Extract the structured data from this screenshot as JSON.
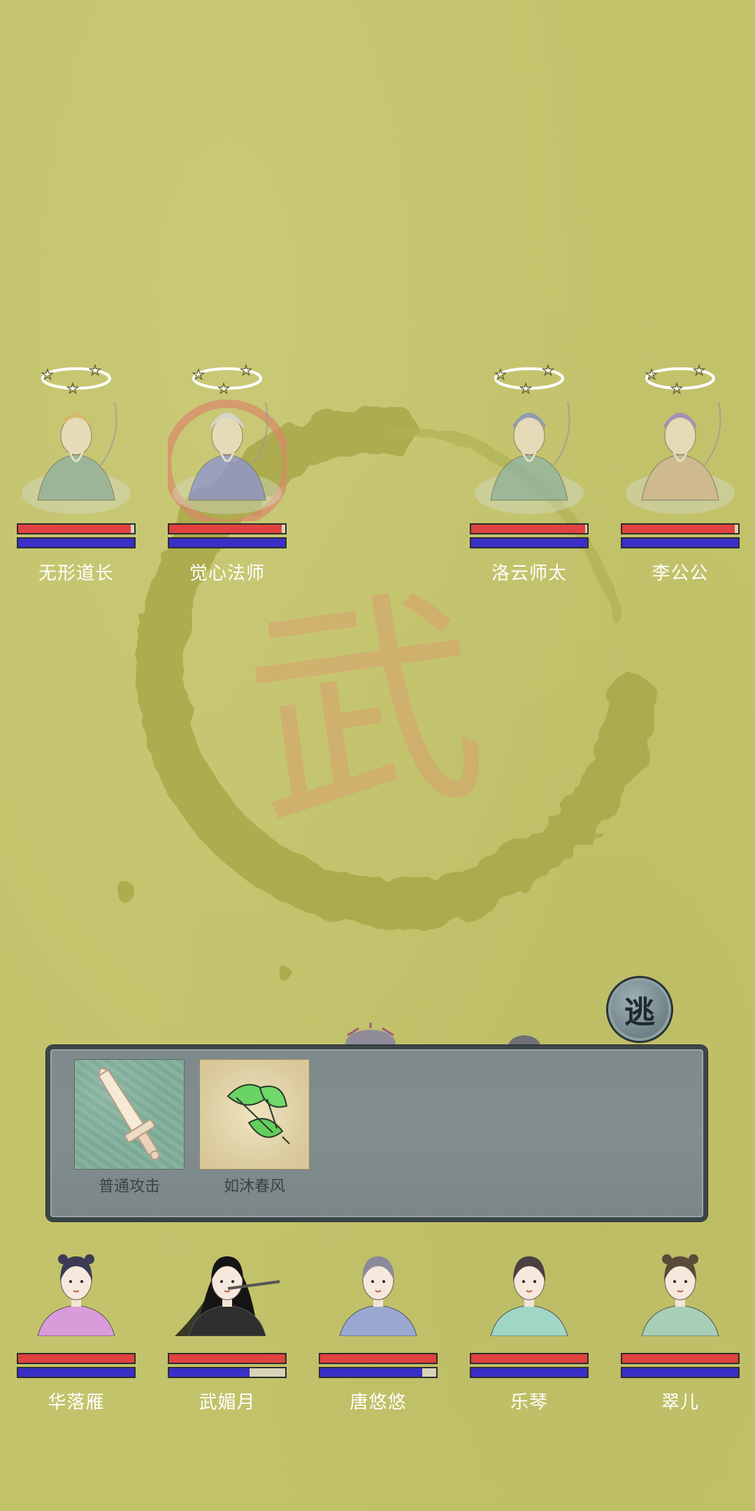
{
  "enemies": [
    {
      "name": "无形道长",
      "hp": 0.97,
      "mp": 1.0,
      "stunned": true,
      "robe": "#8fb0a2",
      "hat": "#d7b86a"
    },
    {
      "name": "觉心法师",
      "hp": 0.97,
      "mp": 1.0,
      "stunned": true,
      "robe": "#8d93d8",
      "hat": "#d9d9e6",
      "targeted": true
    },
    {
      "name": "洛云师太",
      "hp": 0.98,
      "mp": 1.0,
      "stunned": true,
      "robe": "#8fb4a4",
      "hat": "#7e90c6"
    },
    {
      "name": "李公公",
      "hp": 0.97,
      "mp": 1.0,
      "stunned": true,
      "robe": "#d3b89a",
      "hat": "#a07fc9"
    }
  ],
  "allies": [
    {
      "name": "华落雁",
      "hp": 1.0,
      "mp": 1.0,
      "robe": "#d99bd9",
      "hair": "#3b3b55"
    },
    {
      "name": "武媚月",
      "hp": 1.0,
      "mp": 0.69,
      "robe": "#2f2f2f",
      "hair": "#151515"
    },
    {
      "name": "唐悠悠",
      "hp": 1.0,
      "mp": 0.88,
      "robe": "#98a8d0",
      "hair": "#8a8a9a"
    },
    {
      "name": "乐琴",
      "hp": 1.0,
      "mp": 1.0,
      "robe": "#9fd6c6",
      "hair": "#4a4040"
    },
    {
      "name": "翠儿",
      "hp": 1.0,
      "mp": 1.0,
      "robe": "#a6cfb5",
      "hair": "#5a4a3a"
    }
  ],
  "skills": [
    {
      "id": "attack",
      "label": "普通攻击",
      "icon": "sword-icon"
    },
    {
      "id": "spring",
      "label": "如沐春风",
      "icon": "leaves-icon"
    }
  ],
  "flee": {
    "label": "逃"
  },
  "emblem": {
    "glyph": "武"
  },
  "colors": {
    "background": "#c3c36b",
    "hp": "#e0423f",
    "mp": "#3a2fc7",
    "panel": "#7e8a8c"
  }
}
